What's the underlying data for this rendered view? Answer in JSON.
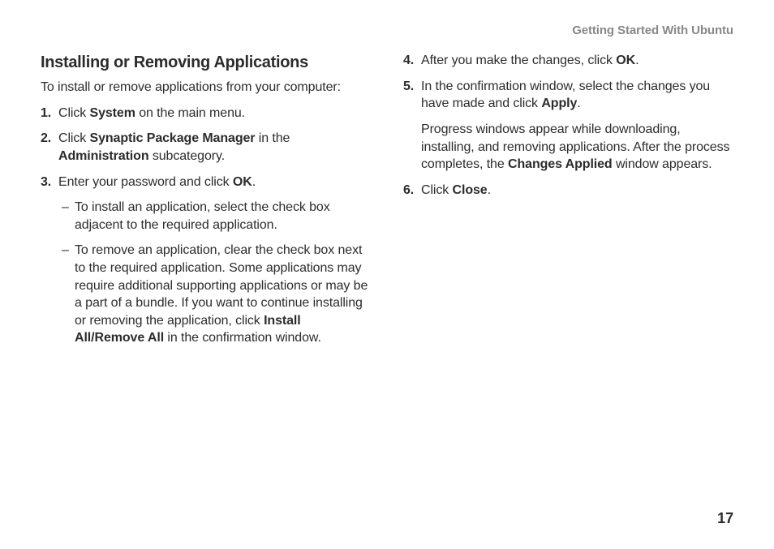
{
  "header": {
    "chapter": "Getting Started With Ubuntu"
  },
  "section": {
    "title": "Installing or Removing Applications",
    "intro": "To install or remove applications from your computer:"
  },
  "left_steps": {
    "s1": {
      "num": "1.",
      "pre": "Click ",
      "b1": "System",
      "post": " on the main menu."
    },
    "s2": {
      "num": "2.",
      "pre": "Click ",
      "b1": "Synaptic Package Manager",
      "mid": " in the ",
      "b2": "Administration",
      "post": " subcategory."
    },
    "s3": {
      "num": "3.",
      "pre": "Enter your password and click ",
      "b1": "OK",
      "post": "."
    },
    "s3a": {
      "dash": "–",
      "text": "To install an application, select the check box adjacent to the required application."
    },
    "s3b": {
      "dash": "–",
      "pre": "To remove an application, clear the check box next to the required application. Some applications may require additional supporting applications or may be a part of a bundle. If you want to continue installing or removing the application, click ",
      "b1": "Install All/Remove All",
      "post": " in the confirmation window."
    }
  },
  "right_steps": {
    "s4": {
      "num": "4.",
      "pre": "After you make the changes, click ",
      "b1": "OK",
      "post": "."
    },
    "s5": {
      "num": "5.",
      "pre": "In the confirmation window, select the changes you have made and click ",
      "b1": "Apply",
      "post": "."
    },
    "s5_note": {
      "pre": "Progress windows appear while downloading, installing, and removing applications. After the process completes, the ",
      "b1": "Changes Applied",
      "post": " window appears."
    },
    "s6": {
      "num": "6.",
      "pre": "Click ",
      "b1": "Close",
      "post": "."
    }
  },
  "page_number": "17"
}
